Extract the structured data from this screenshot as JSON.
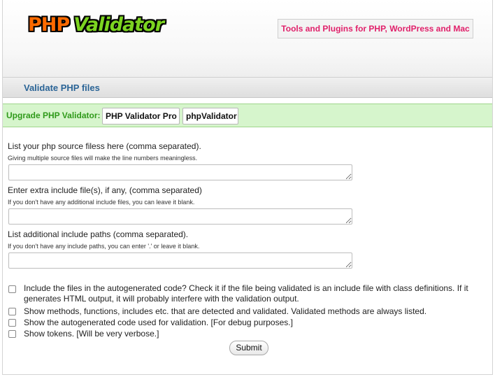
{
  "header": {
    "logo_php": "PHP",
    "logo_validator": "Validator",
    "tools_link": "Tools and Plugins for PHP, WordPress and Mac"
  },
  "title_bar": {
    "title": "Validate PHP files"
  },
  "upgrade": {
    "label": "Upgrade PHP Validator:",
    "pro_button": "PHP Validator Pro",
    "phpvalidator_button": "phpValidator"
  },
  "form": {
    "source_files": {
      "label": "List your php source filess here (comma separated).",
      "hint": "Giving multiple source files will make the line numbers meaningless.",
      "value": ""
    },
    "include_files": {
      "label": "Enter extra include file(s), if any, (comma separated)",
      "hint": "If you don't have any additional include files, you can leave it blank.",
      "value": ""
    },
    "include_paths": {
      "label": "List additional include paths (comma separated).",
      "hint": "If you don't have any include paths, you can enter '.' or leave it blank.",
      "value": ""
    },
    "options": [
      {
        "label": "Include the files in the autogenerated code? Check it if the file being validated is an include file with class definitions. If it generates HTML output, it will probably interfere with the validation output.",
        "checked": false
      },
      {
        "label": "Show methods, functions, includes etc. that are detected and validated. Validated methods are always listed.",
        "checked": false
      },
      {
        "label": "Show the autogenerated code used for validation. [For debug purposes.]",
        "checked": false
      },
      {
        "label": "Show tokens. [Will be very verbose.]",
        "checked": false
      }
    ],
    "submit_label": "Submit"
  }
}
